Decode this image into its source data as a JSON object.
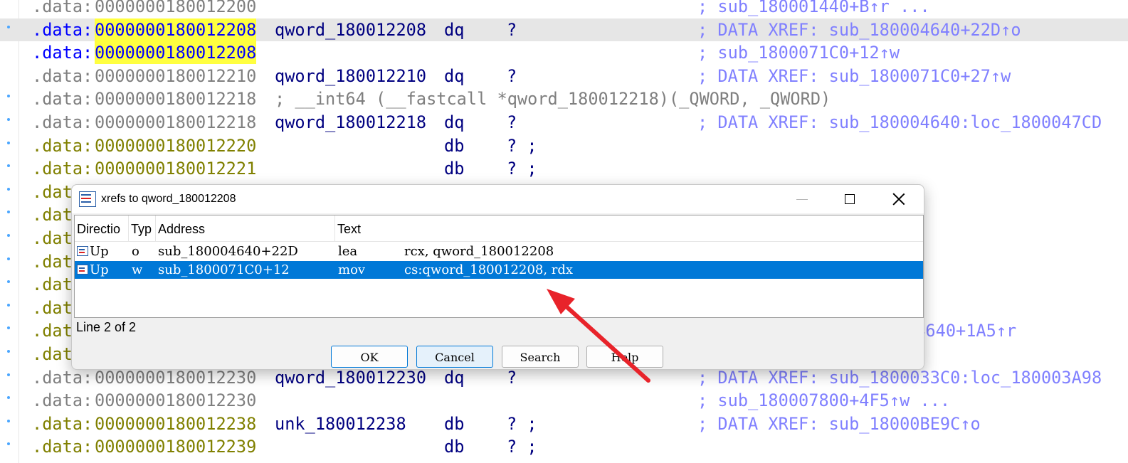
{
  "listing": {
    "lines": [
      {
        "seg": ".data:",
        "addr": "0000000180012200",
        "name": "",
        "dir": "",
        "val": "",
        "cmt": "; sub_180001440+B↑r ..."
      },
      {
        "seg": ".data:",
        "addr": "0000000180012208",
        "name": "qword_180012208",
        "dir": "dq",
        "val": "?",
        "cmt": "; DATA XREF: sub_180004640+22D↑o"
      },
      {
        "seg": ".data:",
        "addr": "0000000180012208",
        "name": "",
        "dir": "",
        "val": "",
        "cmt": "; sub_1800071C0+12↑w"
      },
      {
        "seg": ".data:",
        "addr": "0000000180012210",
        "name": "qword_180012210",
        "dir": "dq",
        "val": "?",
        "cmt": "; DATA XREF: sub_1800071C0+27↑w"
      },
      {
        "seg": ".data:",
        "addr": "0000000180012218",
        "name": "; __int64 (__fastcall *qword_180012218)(_QWORD, _QWORD)",
        "dir": "",
        "val": "",
        "cmt": ""
      },
      {
        "seg": ".data:",
        "addr": "0000000180012218",
        "name": "qword_180012218",
        "dir": "dq",
        "val": "?",
        "cmt": "; DATA XREF: sub_180004640:loc_1800047CD"
      },
      {
        "seg": ".data:",
        "addr": "0000000180012220",
        "name": "",
        "dir": "db",
        "val": "? ;",
        "cmt": ""
      },
      {
        "seg": ".data:",
        "addr": "0000000180012221",
        "name": "",
        "dir": "db",
        "val": "? ;",
        "cmt": ""
      },
      {
        "seg": ".dat",
        "addr": "",
        "name": "",
        "dir": "",
        "val": "",
        "cmt": ""
      },
      {
        "seg": ".dat",
        "addr": "",
        "name": "",
        "dir": "",
        "val": "",
        "cmt": ""
      },
      {
        "seg": ".dat",
        "addr": "",
        "name": "",
        "dir": "",
        "val": "",
        "cmt": ""
      },
      {
        "seg": ".dat",
        "addr": "",
        "name": "",
        "dir": "",
        "val": "",
        "cmt": ""
      },
      {
        "seg": ".dat",
        "addr": "",
        "name": "",
        "dir": "",
        "val": "",
        "cmt": ""
      },
      {
        "seg": ".dat",
        "addr": "",
        "name": "",
        "dir": "",
        "val": "",
        "cmt": ""
      },
      {
        "seg": ".dat",
        "addr": "",
        "name": "",
        "dir": "",
        "val": "",
        "cmt": "04640+1A5↑r"
      },
      {
        "seg": ".dat",
        "addr": "",
        "name": "",
        "dir": "",
        "val": "",
        "cmt": ""
      },
      {
        "seg": ".data:",
        "addr": "0000000180012230",
        "name": "qword_180012230",
        "dir": "dq",
        "val": "?",
        "cmt": "; DATA XREF: sub_1800033C0:loc_180003A98"
      },
      {
        "seg": ".data:",
        "addr": "0000000180012230",
        "name": "",
        "dir": "",
        "val": "",
        "cmt": "; sub_180007800+4F5↑w ..."
      },
      {
        "seg": ".data:",
        "addr": "0000000180012238",
        "name": "unk_180012238",
        "dir": "db",
        "val": "? ;",
        "cmt": "; DATA XREF: sub_18000BE9C↑o"
      },
      {
        "seg": ".data:",
        "addr": "0000000180012239",
        "name": "",
        "dir": "db",
        "val": "? ;",
        "cmt": ""
      }
    ]
  },
  "dialog": {
    "title": "xrefs to qword_180012208",
    "columns": [
      "Directio",
      "Typ",
      "Address",
      "Text"
    ],
    "rows": [
      {
        "direction": "Up",
        "type": "o",
        "address": "sub_180004640+22D",
        "mnemonic": "lea",
        "operands": "rcx, qword_180012208"
      },
      {
        "direction": "Up",
        "type": "w",
        "address": "sub_1800071C0+12",
        "mnemonic": "mov",
        "operands": "cs:qword_180012208, rdx"
      }
    ],
    "status": "Line 2 of 2",
    "buttons": {
      "ok": "OK",
      "cancel": "Cancel",
      "search": "Search",
      "help": "Help"
    }
  },
  "colors": {
    "selection": "#0078d7",
    "highlight_address": "#ffff40",
    "annotation_arrow": "#e8232a",
    "comment": "#8080ff",
    "name": "#000080"
  }
}
